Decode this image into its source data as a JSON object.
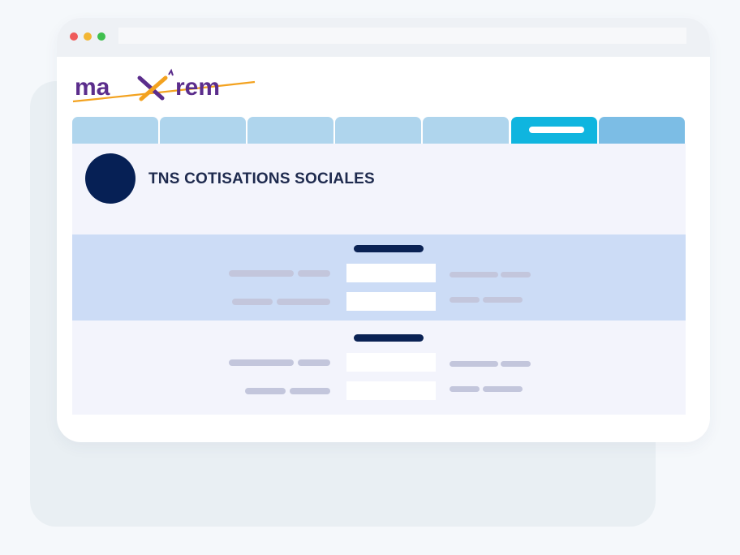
{
  "colors": {
    "page_background": "#f5f8fb",
    "tab_default": "#afd5ed",
    "tab_active": "#0fb5df",
    "tab_last": "#7cbde5",
    "accent_navy": "#062055",
    "section_blue": "#ccdcf6",
    "logo_purple": "#5b2d8c",
    "logo_orange": "#f3a21f"
  },
  "browser": {
    "controls": [
      "close-dot",
      "minimize-dot",
      "maximize-dot"
    ],
    "address_bar": ""
  },
  "brand": {
    "logo_text": "maxirem"
  },
  "nav": {
    "tabs": [
      {
        "label": "",
        "active": false
      },
      {
        "label": "",
        "active": false
      },
      {
        "label": "",
        "active": false
      },
      {
        "label": "",
        "active": false
      },
      {
        "label": "",
        "active": false
      },
      {
        "label": "",
        "active": true
      },
      {
        "label": "",
        "active": false
      }
    ]
  },
  "section": {
    "title": "TNS COTISATIONS SOCIALES",
    "avatar_icon": "profile-avatar"
  },
  "forms": [
    {
      "rows": [
        {
          "input_value": ""
        },
        {
          "input_value": ""
        }
      ]
    },
    {
      "rows": [
        {
          "input_value": ""
        },
        {
          "input_value": ""
        }
      ]
    }
  ]
}
